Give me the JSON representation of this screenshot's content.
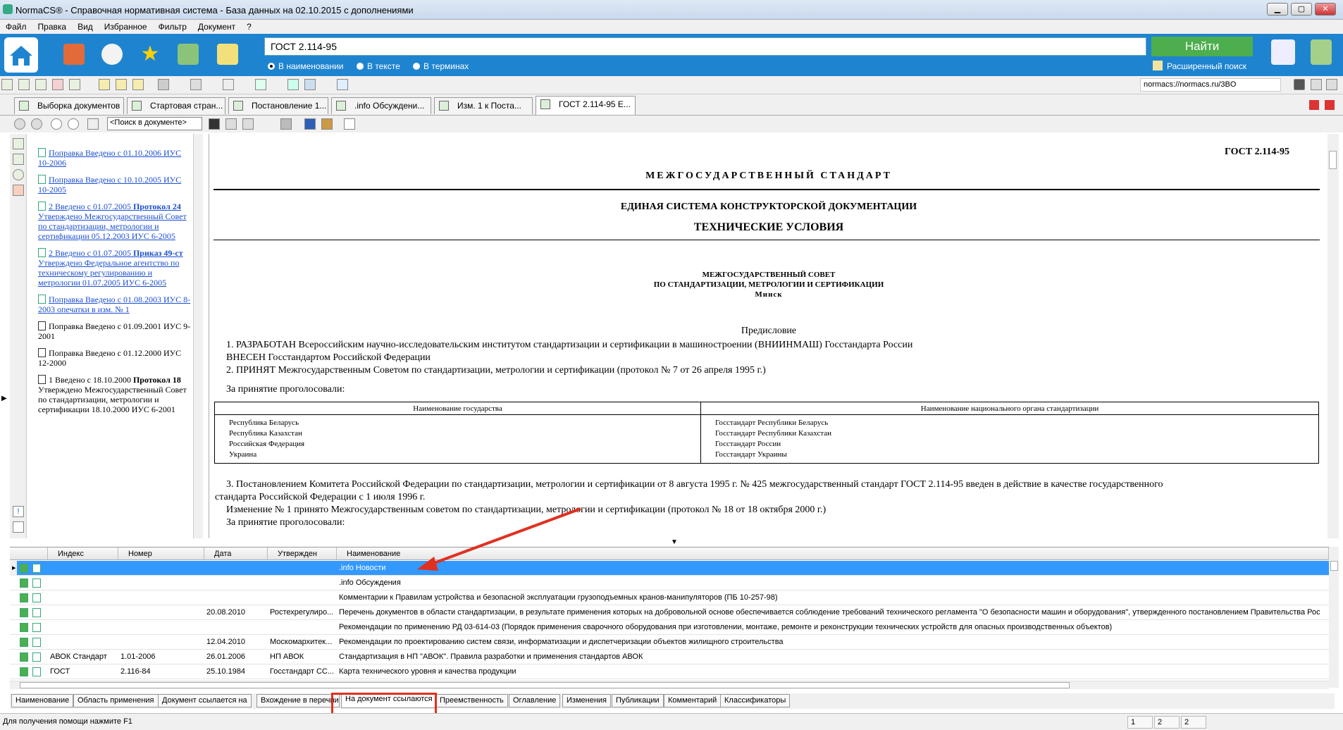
{
  "window": {
    "title": "NormaCS® - Справочная нормативная система - База данных на 02.10.2015  с дополнениями",
    "min": "▁",
    "max": "▢",
    "close": "✕"
  },
  "menu": [
    "Файл",
    "Правка",
    "Вид",
    "Избранное",
    "Фильтр",
    "Документ",
    "?"
  ],
  "search": {
    "value": "ГОСТ 2.114-95",
    "button": "Найти",
    "modes": [
      "В наименовании",
      "В тексте",
      "В терминах"
    ],
    "advanced": "Расширенный поиск"
  },
  "url": "normacs://normacs.ru/3BO",
  "doc_tabs": [
    "Выборка документов",
    "Стартовая стран...",
    "Постановление 1...",
    ".info Обсуждени...",
    "Изм. 1  к Поста...",
    "ГОСТ 2.114-95 Е..."
  ],
  "doc_search_placeholder": "<Поиск в документе>",
  "events": [
    {
      "text": "Поправка  Введено с 01.10.2006  ИУС 10-2006",
      "link": true
    },
    {
      "text": "Поправка  Введено с 10.10.2005  ИУС 10-2005",
      "link": true
    },
    {
      "text": "2  Введено с 01.07.2005",
      "bold": "Протокол 24",
      "rest": " Утверждено Межгосударственный Совет по стандартизации, метрологии и сертификации  05.12.2003  ИУС 6-2005",
      "link": true
    },
    {
      "text": "2  Введено с 01.07.2005",
      "bold": "Приказ 49-ст",
      "rest": " Утверждено Федеральное агентство по техническому регулированию и метрологии  01.07.2005  ИУС 6-2005",
      "link": true
    },
    {
      "text": "Поправка  Введено с 01.08.2003  ИУС 8-2003 опечатки в изм. № 1",
      "link": true
    },
    {
      "text": "Поправка  Введено с 01.09.2001  ИУС 9-2001",
      "link": false
    },
    {
      "text": "Поправка  Введено с 01.12.2000  ИУС 12-2000",
      "link": false
    },
    {
      "text": "1  Введено с 18.10.2000",
      "bold": "Протокол 18",
      "rest": " Утверждено Межгосударственный Совет по стандартизации, метрологии и сертификации  18.10.2000  ИУС 6-2001",
      "link": false
    }
  ],
  "document": {
    "code": "ГОСТ 2.114-95",
    "heading": "МЕЖГОСУДАРСТВЕННЫЙ СТАНДАРТ",
    "system": "ЕДИНАЯ СИСТЕМА КОНСТРУКТОРСКОЙ ДОКУМЕНТАЦИИ",
    "subject": "ТЕХНИЧЕСКИЕ УСЛОВИЯ",
    "council1": "МЕЖГОСУДАРСТВЕННЫЙ СОВЕТ",
    "council2": "ПО СТАНДАРТИЗАЦИИ, МЕТРОЛОГИИ И СЕРТИФИКАЦИИ",
    "city": "Минск",
    "preface": "Предисловие",
    "p1": "1. РАЗРАБОТАН Всероссийским научно-исследовательским институтом стандартизации и сертификации в машиностроении (ВНИИНМАШ) Госстандарта России",
    "p1b": "ВНЕСЕН Госстандартом Российской Федерации",
    "p2": "2. ПРИНЯТ Межгосударственным Советом по стандартизации, метрологии и сертификации (протокол № 7 от 26 апреля 1995 г.)",
    "voted": "За принятие проголосовали:",
    "table_h1": "Наименование государства",
    "table_h2": "Наименование национального органа стандартизации",
    "states": [
      "Республика Беларусь",
      "Республика Казахстан",
      "Российская Федерация",
      "Украина"
    ],
    "bodies": [
      "Госстандарт Республики Беларусь",
      "Госстандарт Республики Казахстан",
      "Госстандарт России",
      "Госстандарт Украины"
    ],
    "p3a": "3. Постановлением Комитета Российской Федерации по стандартизации, метрологии и сертификации от 8 августа 1995 г. № 425 межгосударственный стандарт ГОСТ 2.114-95 введен в действие в качестве государственного",
    "p3b": "стандарта Российской Федерации с 1 июля 1996 г.",
    "p4": "Изменение № 1 принято Межгосударственным советом по стандартизации, метрологии и сертификации (протокол № 18 от 18 октября 2000 г.)",
    "voted2": "За принятие проголосовали:"
  },
  "grid": {
    "columns": [
      "Индекс",
      "Номер",
      "Дата",
      "Утвержден",
      "Наименование"
    ],
    "rows": [
      {
        "index": "",
        "number": "",
        "date": "",
        "approved": "",
        "name": ".info Новости",
        "selected": true
      },
      {
        "index": "",
        "number": "",
        "date": "",
        "approved": "",
        "name": ".info Обсуждения"
      },
      {
        "index": "",
        "number": "",
        "date": "",
        "approved": "",
        "name": "Комментарии к Правилам устройства и безопасной эксплуатации грузоподъемных кранов-манипуляторов (ПБ 10-257-98)"
      },
      {
        "index": "",
        "number": "",
        "date": "20.08.2010",
        "approved": "Ростехрегулиро...",
        "name": "Перечень документов в области стандартизации, в результате применения которых на добровольной основе обеспечивается соблюдение требований технического регламента \"О безопасности машин и оборудования\", утвержденного постановлением Правительства Рос"
      },
      {
        "index": "",
        "number": "",
        "date": "",
        "approved": "",
        "name": "Рекомендации по применению РД 03-614-03 (Порядок применения сварочного оборудования при изготовлении, монтаже, ремонте и реконструкции технических устройств для опасных производственных объектов)"
      },
      {
        "index": "",
        "number": "",
        "date": "12.04.2010",
        "approved": "Москомархитек...",
        "name": "Рекомендации по проектированию систем связи, информатизации и диспетчеризации объектов жилищного строительства"
      },
      {
        "index": "АВОК Стандарт",
        "number": "1.01-2006",
        "date": "26.01.2006",
        "approved": "НП АВОК",
        "name": "Стандартизация в НП \"АВОК\". Правила разработки и применения стандартов АВОК"
      },
      {
        "index": "ГОСТ",
        "number": "2.116-84",
        "date": "25.10.1984",
        "approved": "Госстандарт СС...",
        "name": "Карта технического уровня и качества продукции"
      }
    ]
  },
  "bottom_tabs": [
    "Наименование",
    "Область применения",
    "Документ ссылается на",
    "Вхождение в перечни",
    "На документ ссылаются",
    "Преемственность",
    "Оглавление",
    "Изменения",
    "Публикации",
    "Комментарий",
    "Классификаторы"
  ],
  "active_bottom_tab": "На документ ссылаются",
  "status": {
    "help": "Для получения помощи нажмите F1",
    "boxes": [
      "1",
      "2",
      "2"
    ]
  },
  "colors": {
    "accent": "#1e84d0",
    "find": "#4cae4c",
    "selection": "#3399ff",
    "highlight": "#e03020"
  }
}
